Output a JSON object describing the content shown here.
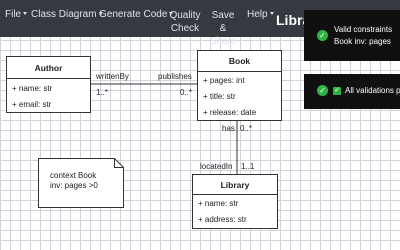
{
  "menu": {
    "file": "File",
    "class_diagram": "Class Diagram",
    "generate_code": "Generate Code",
    "quality_check_1": "Quality",
    "quality_check_2": "Check",
    "save_share_1": "Save &",
    "save_share_2": "Share",
    "help": "Help",
    "app_title": "Libra"
  },
  "classes": {
    "author": {
      "name": "Author",
      "attrs": [
        "+ name: str",
        "+ email: str"
      ]
    },
    "book": {
      "name": "Book",
      "attrs": [
        "+ pages: int",
        "+ title: str",
        "+ release: date"
      ]
    },
    "library": {
      "name": "Library",
      "attrs": [
        "+ name: str",
        "+ address: str"
      ]
    }
  },
  "associations": {
    "author_book": {
      "role_author_side": "writtenBy",
      "role_book_side": "publishes",
      "mult_author_side": "1..*",
      "mult_book_side": "0..*"
    },
    "book_library": {
      "role_book_side": "has",
      "mult_book_side": "0..*",
      "role_library_side": "locatedIn",
      "mult_library_side": "1..1"
    }
  },
  "note": {
    "line1": "context Book",
    "line2": "inv: pages >0"
  },
  "toasts": {
    "constraints_line1": "Valid constraints",
    "constraints_line2": "Book inv: pages",
    "validations": "All validations p"
  },
  "colors": {
    "menubar": "#343a40",
    "success": "#2fb344",
    "toast_bg": "#101010"
  },
  "icons": [
    "chevron-down-icon",
    "check-circle-icon",
    "checkbox-checked-icon"
  ]
}
